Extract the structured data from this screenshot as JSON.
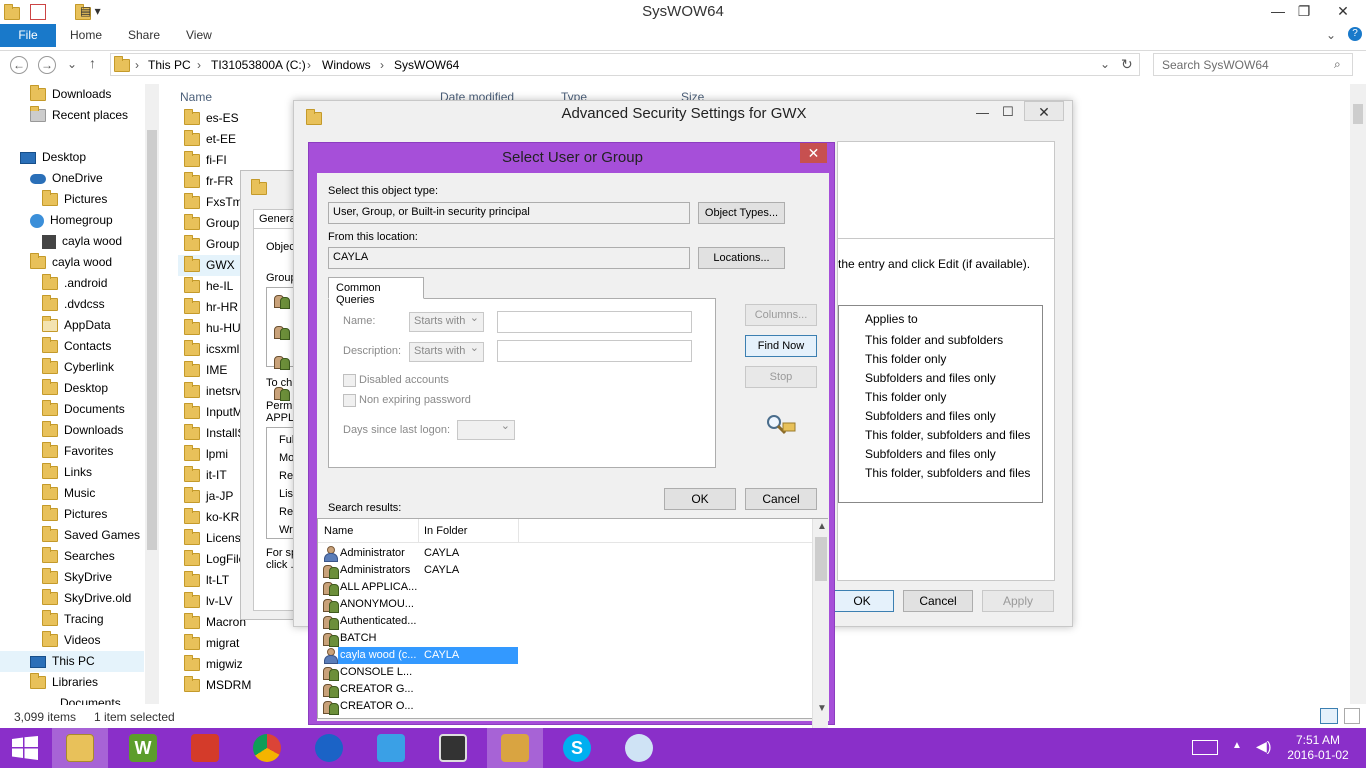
{
  "explorer": {
    "title": "SysWOW64",
    "tabs": [
      "File",
      "Home",
      "Share",
      "View"
    ],
    "breadcrumb": [
      "This PC",
      "TI31053800A (C:)",
      "Windows",
      "SysWOW64"
    ],
    "search_placeholder": "Search SysWOW64",
    "columns": {
      "name": "Name",
      "date": "Date modified",
      "type": "Type",
      "size": "Size"
    },
    "nav_items": [
      "Downloads",
      "Recent places",
      "Desktop",
      "OneDrive",
      "Pictures",
      "Homegroup",
      "cayla wood",
      "cayla wood",
      ".android",
      ".dvdcss",
      "AppData",
      "Contacts",
      "Cyberlink",
      "Desktop",
      "Documents",
      "Downloads",
      "Favorites",
      "Links",
      "Music",
      "Pictures",
      "Saved Games",
      "Searches",
      "SkyDrive",
      "SkyDrive.old",
      "Tracing",
      "Videos",
      "This PC",
      "Libraries",
      "Documents"
    ],
    "files": [
      "es-ES",
      "et-EE",
      "fi-FI",
      "fr-FR",
      "FxsTmp",
      "GroupP",
      "GroupP",
      "GWX",
      "he-IL",
      "hr-HR",
      "hu-HU",
      "icsxml",
      "IME",
      "inetsrv",
      "InputM",
      "InstallS",
      "lpmi",
      "it-IT",
      "ja-JP",
      "ko-KR",
      "License",
      "LogFile",
      "lt-LT",
      "lv-LV",
      "Macron",
      "migrat",
      "migwiz",
      "MSDRM"
    ],
    "status_items": "3,099 items",
    "status_selected": "1 item selected"
  },
  "advanced": {
    "title": "Advanced Security Settings for GWX",
    "hint": "the entry and click Edit (if available).",
    "applies_header": "Applies to",
    "applies": [
      "This folder and subfolders",
      "This folder only",
      "Subfolders and files only",
      "This folder only",
      "Subfolders and files only",
      "This folder, subfolders and files",
      "Subfolders and files only",
      "This folder, subfolders and files"
    ],
    "ok": "OK",
    "cancel": "Cancel",
    "apply": "Apply"
  },
  "props": {
    "tab": "Genera",
    "obj": "Objec",
    "group": "Group",
    "to_change": "To ch",
    "perms": "Permi",
    "appl": "APPL",
    "perm_rows": [
      "Ful",
      "Mo",
      "Re",
      "List",
      "Re",
      "Wr"
    ],
    "special": "For sp",
    "click": "click ."
  },
  "select_dialog": {
    "title": "Select User or Group",
    "object_type_label": "Select this object type:",
    "object_type_value": "User, Group, or Built-in security principal",
    "object_types_btn": "Object Types...",
    "location_label": "From this location:",
    "location_value": "CAYLA",
    "locations_btn": "Locations...",
    "common_queries_tab": "Common Queries",
    "name_label": "Name:",
    "description_label": "Description:",
    "starts_with": "Starts with",
    "disabled_accounts": "Disabled accounts",
    "non_expiring": "Non expiring password",
    "days_since": "Days since last logon:",
    "columns_btn": "Columns...",
    "find_now_btn": "Find Now",
    "stop_btn": "Stop",
    "ok_btn": "OK",
    "cancel_btn": "Cancel",
    "search_results_label": "Search results:",
    "results_col_name": "Name",
    "results_col_folder": "In Folder",
    "results": [
      {
        "name": "Administrator",
        "folder": "CAYLA",
        "icon": "user-icon"
      },
      {
        "name": "Administrators",
        "folder": "CAYLA",
        "icon": "group-icon"
      },
      {
        "name": "ALL APPLICA...",
        "folder": "",
        "icon": "group-icon"
      },
      {
        "name": "ANONYMOU...",
        "folder": "",
        "icon": "group-icon"
      },
      {
        "name": "Authenticated...",
        "folder": "",
        "icon": "group-icon"
      },
      {
        "name": "BATCH",
        "folder": "",
        "icon": "group-icon"
      },
      {
        "name": "cayla wood (c...",
        "folder": "CAYLA",
        "icon": "user-icon",
        "selected": true
      },
      {
        "name": "CONSOLE L...",
        "folder": "",
        "icon": "group-icon"
      },
      {
        "name": "CREATOR G...",
        "folder": "",
        "icon": "group-icon"
      },
      {
        "name": "CREATOR O...",
        "folder": "",
        "icon": "group-icon"
      }
    ]
  },
  "taskbar": {
    "time": "7:51 AM",
    "date": "2016-01-02",
    "accent": "#8a2fc9"
  }
}
